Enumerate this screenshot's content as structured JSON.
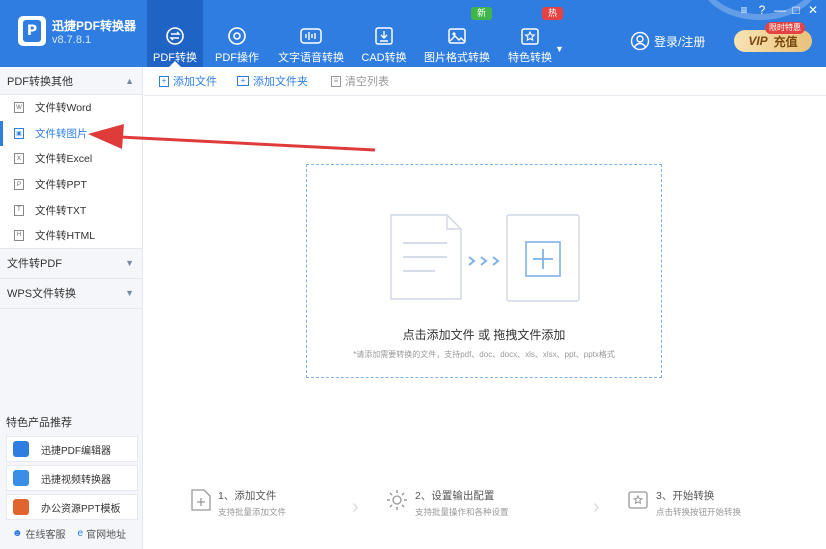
{
  "app": {
    "title": "迅捷PDF转换器",
    "version": "v8.7.8.1"
  },
  "nav": [
    {
      "label": "PDF转换",
      "icon": "convert-icon",
      "active": true
    },
    {
      "label": "PDF操作",
      "icon": "disc-icon"
    },
    {
      "label": "文字语音转换",
      "icon": "audio-wave-icon"
    },
    {
      "label": "CAD转换",
      "icon": "cad-icon"
    },
    {
      "label": "图片格式转换",
      "icon": "image-icon"
    },
    {
      "label": "特色转换",
      "icon": "star-box-icon"
    }
  ],
  "badges": {
    "new": "新",
    "hot": "热"
  },
  "account": {
    "login_label": "登录/注册",
    "vip_label": "VIP",
    "vip_action": "充值",
    "vip_tag": "限时特惠"
  },
  "sidebar": {
    "groups": [
      {
        "label": "PDF转换其他",
        "expanded": true,
        "items": [
          "文件转Word",
          "文件转图片",
          "文件转Excel",
          "文件转PPT",
          "文件转TXT",
          "文件转HTML"
        ]
      },
      {
        "label": "文件转PDF",
        "expanded": false
      },
      {
        "label": "WPS文件转换",
        "expanded": false
      }
    ],
    "active_item": "文件转图片",
    "promo_title": "特色产品推荐",
    "promos": [
      "迅捷PDF编辑器",
      "迅捷视频转换器",
      "办公资源PPT模板"
    ],
    "footer": {
      "service": "在线客服",
      "website": "官网地址"
    }
  },
  "toolbar": {
    "add_file": "添加文件",
    "add_folder": "添加文件夹",
    "clear_list": "清空列表"
  },
  "dropzone": {
    "text": "点击添加文件 或 拖拽文件添加",
    "hint": "*请添加需要转换的文件，支持pdf、doc、docx、xls、xlsx、ppt、pptx格式"
  },
  "steps": [
    {
      "title": "1、添加文件",
      "desc": "支持批量添加文件"
    },
    {
      "title": "2、设置输出配置",
      "desc": "支持批量操作和各种设置"
    },
    {
      "title": "3、开始转换",
      "desc": "点击转换按钮开始转换"
    }
  ],
  "colors": {
    "brand": "#2f7de1",
    "nav_active": "#1f63c4",
    "annotation": "#e03b3b"
  }
}
